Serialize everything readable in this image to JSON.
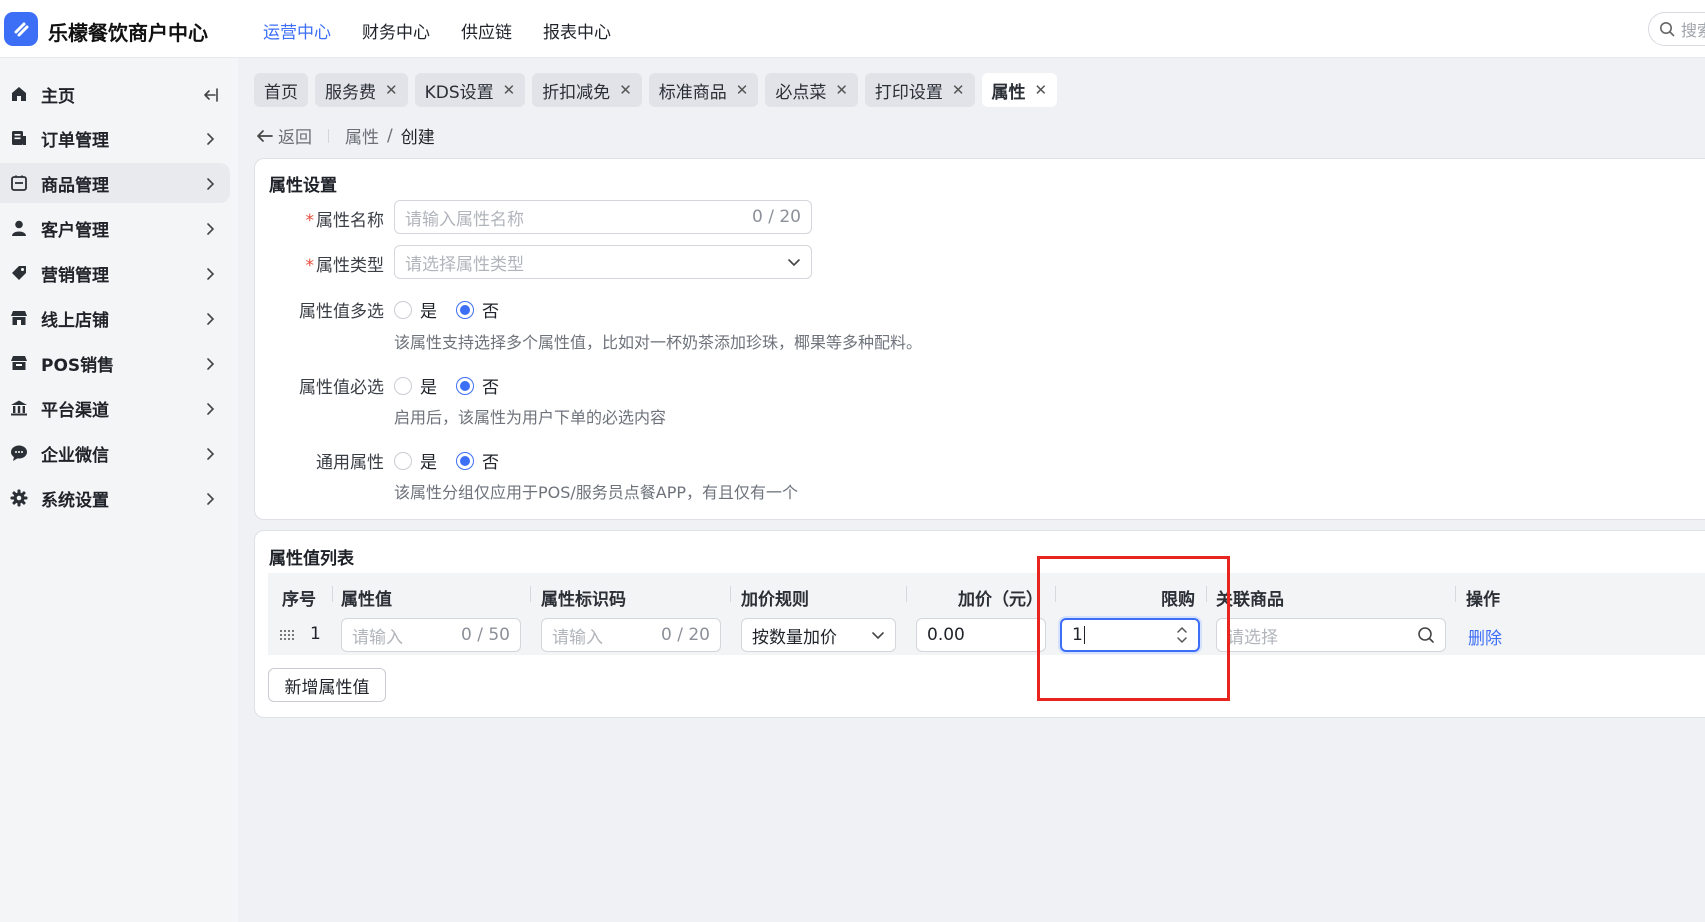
{
  "app": {
    "title": "乐檬餐饮商户中心"
  },
  "topnav": {
    "items": [
      {
        "label": "运营中心",
        "active": true
      },
      {
        "label": "财务中心"
      },
      {
        "label": "供应链"
      },
      {
        "label": "报表中心"
      }
    ]
  },
  "search": {
    "placeholder": "搜索"
  },
  "sidebar": {
    "items": [
      {
        "label": "主页",
        "icon": "home-icon"
      },
      {
        "label": "订单管理",
        "icon": "order-icon"
      },
      {
        "label": "商品管理",
        "icon": "product-icon",
        "active": true
      },
      {
        "label": "客户管理",
        "icon": "user-icon"
      },
      {
        "label": "营销管理",
        "icon": "tag-icon"
      },
      {
        "label": "线上店铺",
        "icon": "store-icon"
      },
      {
        "label": "POS销售",
        "icon": "pos-icon"
      },
      {
        "label": "平台渠道",
        "icon": "bank-icon"
      },
      {
        "label": "企业微信",
        "icon": "chat-icon"
      },
      {
        "label": "系统设置",
        "icon": "gear-icon"
      }
    ]
  },
  "tabs": [
    {
      "label": "首页",
      "closable": false
    },
    {
      "label": "服务费",
      "closable": true
    },
    {
      "label": "KDS设置",
      "closable": true
    },
    {
      "label": "折扣减免",
      "closable": true
    },
    {
      "label": "标准商品",
      "closable": true
    },
    {
      "label": "必点菜",
      "closable": true
    },
    {
      "label": "打印设置",
      "closable": true
    },
    {
      "label": "属性",
      "closable": true,
      "active": true
    }
  ],
  "breadcrumb": {
    "back": "返回",
    "parent": "属性",
    "separator": "/",
    "current": "创建"
  },
  "settings": {
    "title": "属性设置",
    "name": {
      "label": "属性名称",
      "placeholder": "请输入属性名称",
      "count": "0 / 20"
    },
    "type": {
      "label": "属性类型",
      "placeholder": "请选择属性类型"
    },
    "multi": {
      "label": "属性值多选",
      "yes": "是",
      "no": "否",
      "selected": "否",
      "hint": "该属性支持选择多个属性值，比如对一杯奶茶添加珍珠，椰果等多种配料。"
    },
    "required": {
      "label": "属性值必选",
      "yes": "是",
      "no": "否",
      "selected": "否",
      "hint": "启用后，该属性为用户下单的必选内容"
    },
    "common": {
      "label": "通用属性",
      "yes": "是",
      "no": "否",
      "selected": "否",
      "hint": "该属性分组仅应用于POS/服务员点餐APP，有且仅有一个"
    }
  },
  "values": {
    "title": "属性值列表",
    "columns": [
      "序号",
      "属性值",
      "属性标识码",
      "加价规则",
      "加价（元）",
      "限购",
      "关联商品",
      "操作"
    ],
    "rows": [
      {
        "index": "1",
        "value_placeholder": "请输入",
        "value_count": "0 / 50",
        "code_placeholder": "请输入",
        "code_count": "0 / 20",
        "rule": "按数量加价",
        "price": "0.00",
        "limit": "1",
        "product_placeholder": "请选择",
        "action": "删除"
      }
    ],
    "add_button": "新增属性值"
  },
  "colors": {
    "accent": "#3d6ef6",
    "highlight": "#e8241f"
  }
}
